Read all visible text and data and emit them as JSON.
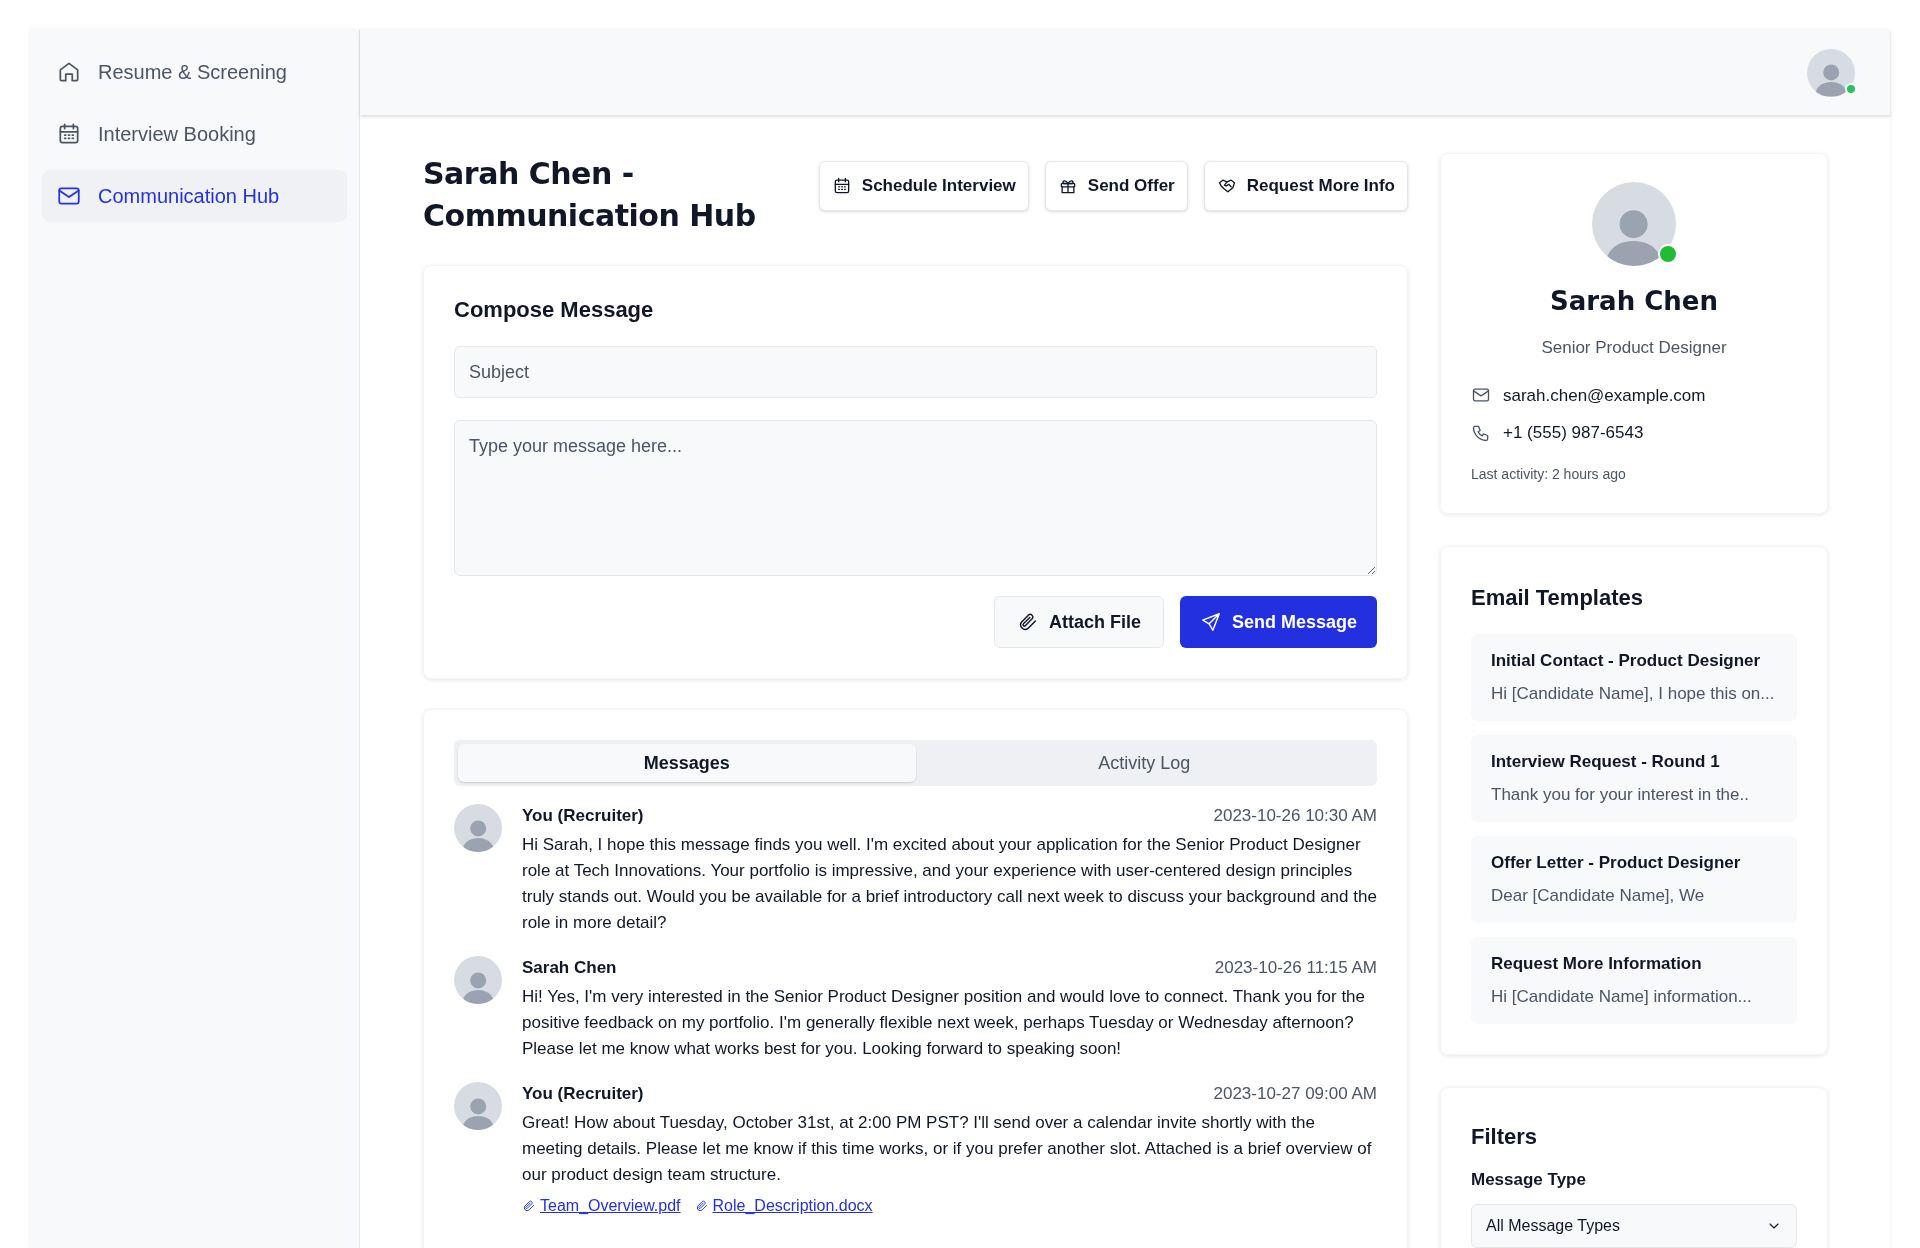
{
  "sidebar": {
    "items": [
      {
        "label": "Resume & Screening",
        "selected": false
      },
      {
        "label": "Interview Booking",
        "selected": false
      },
      {
        "label": "Communication Hub",
        "selected": true
      }
    ]
  },
  "header": {
    "user_online": true
  },
  "title": "Sarah Chen - Communication Hub",
  "actions": [
    {
      "label": "Schedule Interview"
    },
    {
      "label": "Send Offer"
    },
    {
      "label": "Request More Info"
    }
  ],
  "compose": {
    "title": "Compose Message",
    "subject_placeholder": "Subject",
    "message_placeholder": "Type your message here...",
    "attach_label": "Attach File",
    "send_label": "Send Message"
  },
  "tabs": [
    {
      "label": "Messages",
      "selected": true
    },
    {
      "label": "Activity Log",
      "selected": false
    }
  ],
  "messages": [
    {
      "sender": "You (Recruiter)",
      "time": "2023-10-26 10:30 AM",
      "text": "Hi Sarah, I hope this message finds you well. I'm excited about your application for the Senior Product Designer role at Tech Innovations. Your portfolio is impressive, and your experience with user-centered design principles truly stands out. Would you be available for a brief introductory call next week to discuss your background and the role in more detail?"
    },
    {
      "sender": "Sarah Chen",
      "time": "2023-10-26 11:15 AM",
      "text": "Hi! Yes, I'm very interested in the Senior Product Designer position and would love to connect. Thank you for the positive feedback on my portfolio. I'm generally flexible next week, perhaps Tuesday or Wednesday afternoon? Please let me know what works best for you. Looking forward to speaking soon!"
    },
    {
      "sender": "You (Recruiter)",
      "time": "2023-10-27 09:00 AM",
      "text": "Great! How about Tuesday, October 31st, at 2:00 PM PST? I'll send over a calendar invite shortly with the meeting details. Please let me know if this time works, or if you prefer another slot. Attached is a brief overview of our product design team structure.",
      "attachments": [
        "Team_Overview.pdf",
        "Role_Description.docx"
      ]
    }
  ],
  "profile": {
    "name": "Sarah Chen",
    "role": "Senior Product Designer",
    "email": "sarah.chen@example.com",
    "phone": "+1 (555) 987-6543",
    "last_activity": "Last activity: 2 hours ago",
    "online": true
  },
  "templates": {
    "title": "Email Templates",
    "items": [
      {
        "title": "Initial Contact - Product Designer",
        "preview": "Hi [Candidate Name], I hope this on..."
      },
      {
        "title": "Interview Request - Round 1",
        "preview": "Thank you for your interest in the.."
      },
      {
        "title": "Offer Letter - Product Designer",
        "preview": "Dear [Candidate Name], We"
      },
      {
        "title": "Request More Information",
        "preview": "Hi [Candidate Name] information..."
      }
    ]
  },
  "filters": {
    "title": "Filters",
    "message_type_label": "Message Type",
    "message_type_value": "All Message Types"
  }
}
